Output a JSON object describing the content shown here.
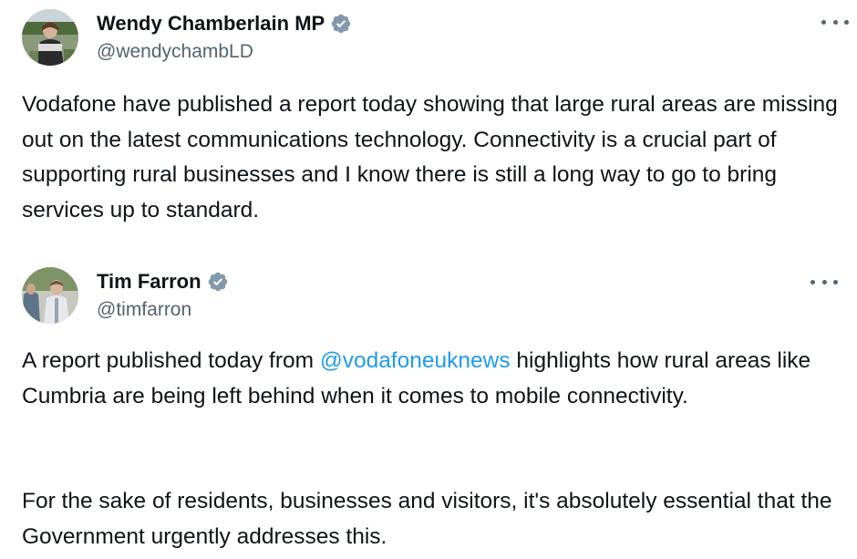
{
  "tweets": [
    {
      "display_name": "Wendy Chamberlain MP",
      "handle": "@wendychambLD",
      "verified": true,
      "avatar_icon": "profile-photo",
      "menu_icon": "more-horizontal-icon",
      "text": "Vodafone have published a report today showing that  large rural areas are missing out on the latest communications technology. Connectivity is a crucial part of supporting rural businesses and I know there is still a long way to go to bring services up to standard."
    },
    {
      "display_name": "Tim Farron",
      "handle": "@timfarron",
      "verified": true,
      "avatar_icon": "profile-photo",
      "menu_icon": "more-horizontal-icon",
      "text_before_mention": "A report published today from ",
      "mention": "@vodafoneuknews",
      "text_after_mention": " highlights how rural areas like Cumbria are being left behind when it comes to mobile connectivity.",
      "text_paragraph_2": "For the sake of residents, businesses and visitors, it's absolutely essential that the Government urgently addresses this."
    }
  ],
  "colors": {
    "text": "#0f1419",
    "secondary": "#536471",
    "link": "#1d9bf0",
    "verified_badge": "#829aab"
  }
}
